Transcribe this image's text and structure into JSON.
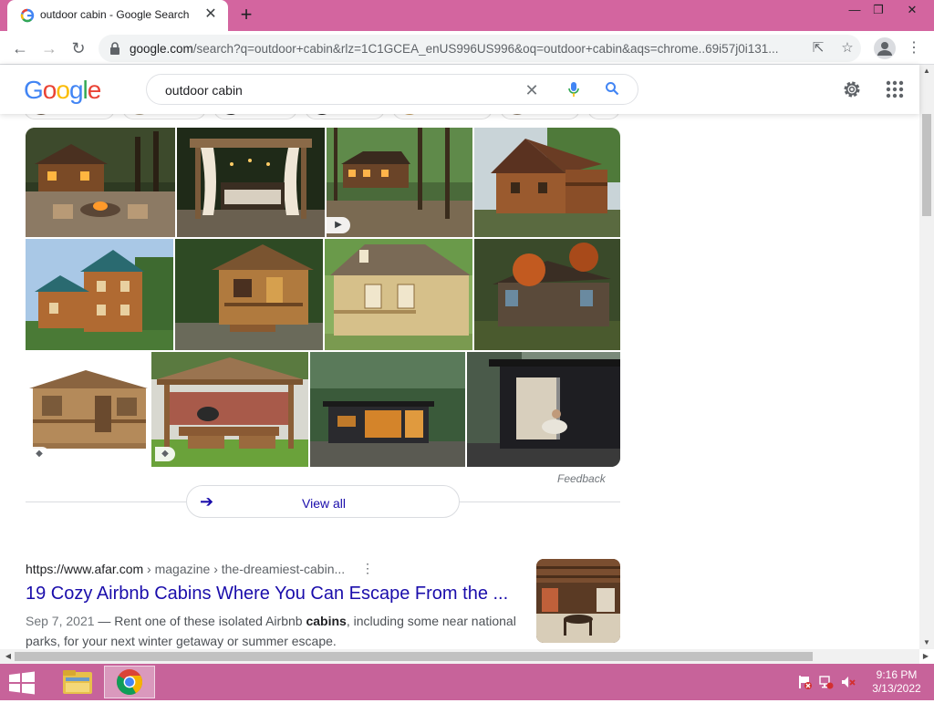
{
  "browser": {
    "tab_title": "outdoor cabin - Google Search",
    "tab_close": "✕",
    "new_tab": "+",
    "url_host": "google.com",
    "url_path": "/search?q=outdoor+cabin&rlz=1C1GCEA_enUS996US996&oq=outdoor+cabin&aqs=chrome..69i57j0i131...",
    "window_controls": {
      "minimize": "—",
      "restore": "❐",
      "close": "✕"
    }
  },
  "google": {
    "logo_letters": [
      {
        "ch": "G",
        "color": "#4285F4"
      },
      {
        "ch": "o",
        "color": "#EA4335"
      },
      {
        "ch": "o",
        "color": "#FBBC05"
      },
      {
        "ch": "g",
        "color": "#4285F4"
      },
      {
        "ch": "l",
        "color": "#34A853"
      },
      {
        "ch": "e",
        "color": "#EA4335"
      }
    ],
    "query": "outdoor cabin"
  },
  "images": {
    "feedback": "Feedback",
    "view_all": "View all",
    "tiles": [
      {
        "name": "image-tile-cabin-firepit",
        "badge": ""
      },
      {
        "name": "image-tile-pergola-curtains",
        "badge": ""
      },
      {
        "name": "image-tile-forest-cabin",
        "badge": "play"
      },
      {
        "name": "image-tile-log-cabin-porch",
        "badge": ""
      },
      {
        "name": "image-tile-two-story-cabin",
        "badge": ""
      },
      {
        "name": "image-tile-small-wood-cabin",
        "badge": ""
      },
      {
        "name": "image-tile-shed-cabin",
        "badge": ""
      },
      {
        "name": "image-tile-dark-cabin-autumn",
        "badge": ""
      },
      {
        "name": "image-tile-playhouse-cabin",
        "badge": "tag"
      },
      {
        "name": "image-tile-outdoor-kitchen",
        "badge": "tag"
      },
      {
        "name": "image-tile-modern-cabin-night",
        "badge": ""
      },
      {
        "name": "image-tile-black-studio",
        "badge": ""
      }
    ]
  },
  "result": {
    "cite_url": "https://www.afar.com",
    "cite_crumbs": " › magazine › the-dreamiest-cabin...",
    "title": "19 Cozy Airbnb Cabins Where You Can Escape From the ...",
    "date": "Sep 7, 2021",
    "snippet_pre": " — Rent one of these isolated Airbnb ",
    "snippet_bold": "cabins",
    "snippet_post": ", including some near national parks, for your next winter getaway or summer escape."
  },
  "taskbar": {
    "time": "9:16 PM",
    "date": "3/13/2022"
  },
  "colors": {
    "accent_pink": "#d3659f",
    "taskbar": "#c7639a",
    "link": "#1a0dab"
  }
}
